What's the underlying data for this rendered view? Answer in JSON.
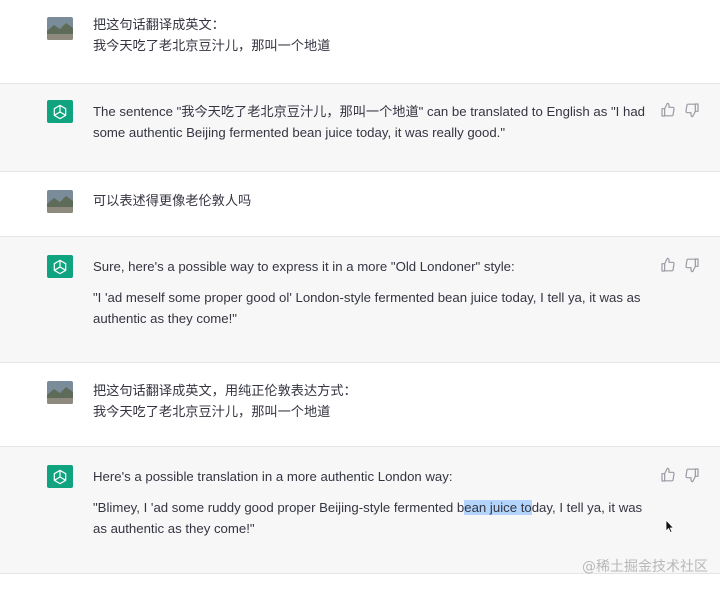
{
  "conversation": [
    {
      "role": "user",
      "lines": [
        "把这句话翻译成英文：",
        "我今天吃了老北京豆汁儿，那叫一个地道"
      ]
    },
    {
      "role": "assistant",
      "paragraphs": [
        {
          "text": "The sentence \"我今天吃了老北京豆汁儿，那叫一个地道\" can be translated to English as \"I had some authentic Beijing fermented bean juice today, it was really good.\""
        }
      ]
    },
    {
      "role": "user",
      "lines": [
        "可以表述得更像老伦敦人吗"
      ]
    },
    {
      "role": "assistant",
      "paragraphs": [
        {
          "text": "Sure, here's a possible way to express it in a more \"Old Londoner\" style:"
        },
        {
          "text": "\"I 'ad meself some proper good ol' London-style fermented bean juice today, I tell ya, it was as authentic as they come!\""
        }
      ]
    },
    {
      "role": "user",
      "lines": [
        "把这句话翻译成英文，用纯正伦敦表达方式：",
        "我今天吃了老北京豆汁儿，那叫一个地道"
      ]
    },
    {
      "role": "assistant",
      "paragraphs": [
        {
          "text": "Here's a possible translation in a more authentic London way:"
        },
        {
          "before": "\"Blimey, I 'ad some ruddy good proper Beijing-style fermented b",
          "highlight": "ean juice to",
          "after": "day, I tell ya, it was as authentic as they come!\""
        }
      ]
    }
  ],
  "feedback": {
    "icons": [
      "thumbs-up-icon",
      "thumbs-down-icon"
    ]
  },
  "watermark": "@稀土掘金技术社区",
  "colors": {
    "assistant_bg": "#f7f7f8",
    "avatar_green": "#10a37f",
    "text": "#343541",
    "selection": "#b3d4fc"
  }
}
